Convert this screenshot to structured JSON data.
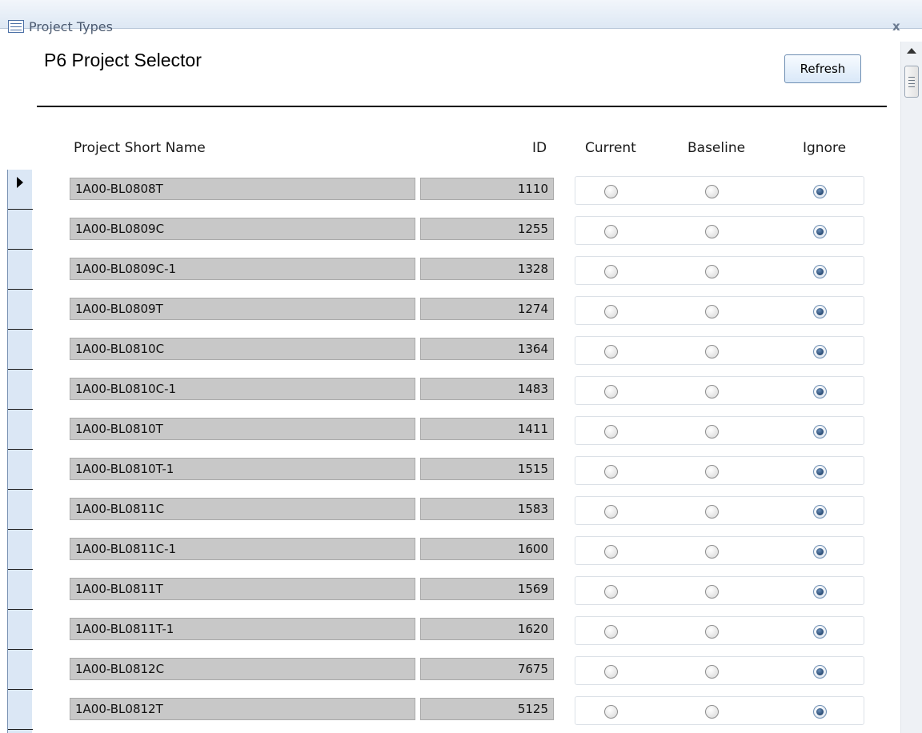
{
  "window": {
    "title": "Project Types",
    "close_label": "x"
  },
  "form": {
    "title": "P6 Project Selector",
    "refresh_label": "Refresh"
  },
  "columns": {
    "name": "Project Short Name",
    "id": "ID",
    "current": "Current",
    "baseline": "Baseline",
    "ignore": "Ignore"
  },
  "rows": [
    {
      "name": "1A00-BL0808T",
      "id": "1110",
      "status": "ignore",
      "is_current_record": true
    },
    {
      "name": "1A00-BL0809C",
      "id": "1255",
      "status": "ignore"
    },
    {
      "name": "1A00-BL0809C-1",
      "id": "1328",
      "status": "ignore"
    },
    {
      "name": "1A00-BL0809T",
      "id": "1274",
      "status": "ignore"
    },
    {
      "name": "1A00-BL0810C",
      "id": "1364",
      "status": "ignore"
    },
    {
      "name": "1A00-BL0810C-1",
      "id": "1483",
      "status": "ignore"
    },
    {
      "name": "1A00-BL0810T",
      "id": "1411",
      "status": "ignore"
    },
    {
      "name": "1A00-BL0810T-1",
      "id": "1515",
      "status": "ignore"
    },
    {
      "name": "1A00-BL0811C",
      "id": "1583",
      "status": "ignore"
    },
    {
      "name": "1A00-BL0811C-1",
      "id": "1600",
      "status": "ignore"
    },
    {
      "name": "1A00-BL0811T",
      "id": "1569",
      "status": "ignore"
    },
    {
      "name": "1A00-BL0811T-1",
      "id": "1620",
      "status": "ignore"
    },
    {
      "name": "1A00-BL0812C",
      "id": "7675",
      "status": "ignore"
    },
    {
      "name": "1A00-BL0812T",
      "id": "5125",
      "status": "ignore"
    }
  ],
  "icons": {
    "form": "form-icon",
    "close": "close-icon",
    "scroll_up": "scroll-up-arrow-icon",
    "record_pointer": "record-pointer-icon"
  }
}
